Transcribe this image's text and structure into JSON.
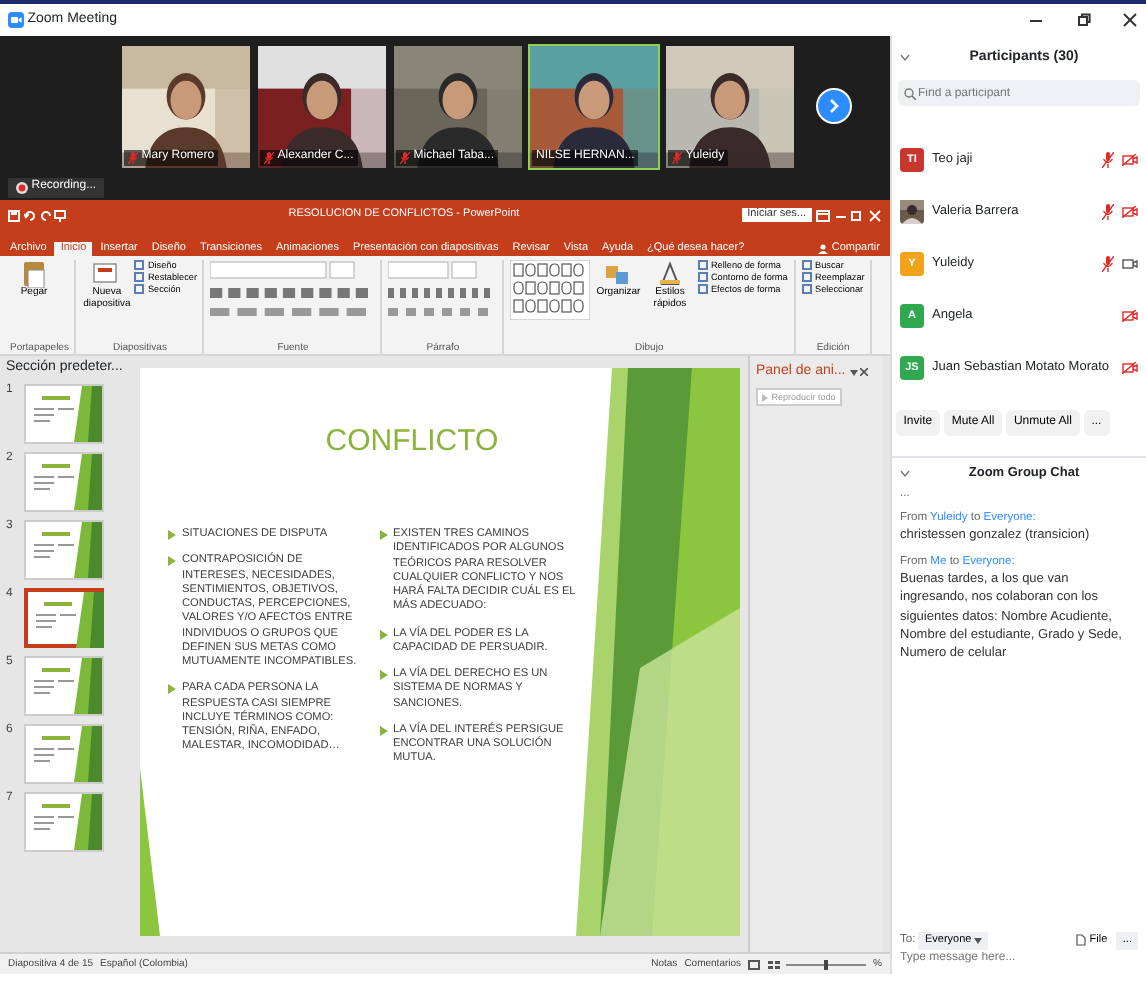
{
  "window": {
    "title": "Zoom Meeting"
  },
  "video_tiles": [
    {
      "name": "Mary Romero",
      "muted": true,
      "active": false
    },
    {
      "name": "Alexander C...",
      "muted": true,
      "active": false
    },
    {
      "name": "Michael Taba...",
      "muted": true,
      "active": false
    },
    {
      "name": "NILSE HERNAN...",
      "muted": false,
      "active": true
    },
    {
      "name": "Yuleidy",
      "muted": true,
      "active": false
    }
  ],
  "recording": {
    "label": "Recording..."
  },
  "powerpoint": {
    "title": "RESOLUCION DE CONFLICTOS - PowerPoint",
    "sign_in": "Iniciar ses...",
    "tabs": [
      {
        "label": "Archivo",
        "selected": false
      },
      {
        "label": "Inicio",
        "selected": true
      },
      {
        "label": "Insertar",
        "selected": false
      },
      {
        "label": "Diseño",
        "selected": false
      },
      {
        "label": "Transiciones",
        "selected": false
      },
      {
        "label": "Animaciones",
        "selected": false
      },
      {
        "label": "Presentación con diapositivas",
        "selected": false
      },
      {
        "label": "Revisar",
        "selected": false
      },
      {
        "label": "Vista",
        "selected": false
      },
      {
        "label": "Ayuda",
        "selected": false
      },
      {
        "label": "¿Qué desea hacer?",
        "selected": false
      }
    ],
    "share": "Compartir",
    "ribbon_groups": [
      {
        "label": "Portapapeles",
        "items": [
          {
            "kind": "large",
            "label": "Pegar"
          }
        ]
      },
      {
        "label": "Diapositivas",
        "items": [
          {
            "kind": "large",
            "label": "Nueva diapositiva"
          },
          {
            "kind": "small",
            "label": "Diseño"
          },
          {
            "kind": "small",
            "label": "Restablecer"
          },
          {
            "kind": "small",
            "label": "Sección"
          }
        ]
      },
      {
        "label": "Fuente",
        "items": [
          {
            "kind": "tools"
          }
        ]
      },
      {
        "label": "Párrafo",
        "items": [
          {
            "kind": "tools"
          }
        ]
      },
      {
        "label": "Dibujo",
        "items": [
          {
            "kind": "gallery"
          },
          {
            "kind": "large",
            "label": "Organizar"
          },
          {
            "kind": "large",
            "label": "Estilos rápidos"
          },
          {
            "kind": "small",
            "label": "Relleno de forma"
          },
          {
            "kind": "small",
            "label": "Contorno de forma"
          },
          {
            "kind": "small",
            "label": "Efectos de forma"
          }
        ]
      },
      {
        "label": "Edición",
        "items": [
          {
            "kind": "small",
            "label": "Buscar"
          },
          {
            "kind": "small",
            "label": "Reemplazar"
          },
          {
            "kind": "small",
            "label": "Seleccionar"
          }
        ]
      }
    ],
    "section": "Sección predeter...",
    "thumbnails": [
      {
        "number": "1",
        "selected": false
      },
      {
        "number": "2",
        "selected": false
      },
      {
        "number": "3",
        "selected": false
      },
      {
        "number": "4",
        "selected": true
      },
      {
        "number": "5",
        "selected": false
      },
      {
        "number": "6",
        "selected": false
      },
      {
        "number": "7",
        "selected": false
      }
    ],
    "slide": {
      "title": "CONFLICTO",
      "left_bullets": [
        "SITUACIONES DE DISPUTA",
        "CONTRAPOSICIÓN DE INTERESES, NECESIDADES, SENTIMIENTOS, OBJETIVOS, CONDUCTAS, PERCEPCIONES, VALORES Y/O AFECTOS ENTRE INDIVIDUOS O GRUPOS QUE DEFINEN SUS METAS COMO MUTUAMENTE INCOMPATIBLES.",
        "PARA CADA PERSONA LA RESPUESTA CASI SIEMPRE INCLUYE TÉRMINOS COMO: TENSIÓN, RIÑA, ENFADO, MALESTAR, INCOMODIDAD…"
      ],
      "right_bullets": [
        "EXISTEN TRES CAMINOS IDENTIFICADOS POR ALGUNOS TEÓRICOS PARA RESOLVER CUALQUIER CONFLICTO Y NOS HARÁ FALTA DECIDIR CUÁL ES EL MÁS ADECUADO:",
        "LA VÍA DEL PODER ES LA CAPACIDAD DE PERSUADIR.",
        "LA VÍA DEL DERECHO ES UN SISTEMA DE NORMAS Y SANCIONES.",
        "LA VÍA DEL INTERÉS PERSIGUE ENCONTRAR UNA SOLUCIÓN MUTUA."
      ]
    },
    "animation_pane": {
      "title": "Panel de ani...",
      "button": "Reproducir todo"
    },
    "status_bar": {
      "slide_count": "Diapositiva 4 de 15",
      "language": "Español (Colombia)",
      "notes": "Notas",
      "comments": "Comentarios",
      "zoom_slider": {
        "level": 0.5
      },
      "zoom": "%"
    }
  },
  "participants": {
    "title": "Participants (30)",
    "search_placeholder": "Find a participant",
    "items": [
      {
        "kind": "initials",
        "initials": "TI",
        "name": "Teo jaji",
        "color": "#c8372d",
        "audio_muted": true,
        "video_off": true
      },
      {
        "name": "Valeria Barrera",
        "audio_muted": true,
        "video_off": true
      },
      {
        "kind": "initials",
        "initials": "Y",
        "name": "Yuleidy",
        "color": "#f0a21b",
        "audio_muted": true,
        "video_off": false
      },
      {
        "kind": "initials",
        "initials": "A",
        "name": "Angela",
        "color": "#2fa84f",
        "audio_muted": false,
        "video_off": true
      },
      {
        "kind": "initials",
        "initials": "JS",
        "name": "Juan Sebastian Motato Morato",
        "color": "#2fa84f",
        "audio_muted": false,
        "video_off": true
      }
    ],
    "buttons": [
      "Invite",
      "Mute All",
      "Unmute All",
      "..."
    ]
  },
  "chat": {
    "title": "Zoom Group Chat",
    "ellipsis": "...",
    "messages": [
      {
        "from": "From",
        "sender": "Yuleidy",
        "to": "to",
        "recipient": "Everyone:",
        "text": "christessen gonzalez (transicion)"
      },
      {
        "from": "From",
        "sender": "Me",
        "to": "to",
        "recipient": "Everyone:",
        "text": "Buenas tardes, a los que van ingresando, nos colaboran con los siguientes datos: Nombre Acudiente, Nombre del estudiante, Grado y Sede, Numero de celular"
      }
    ],
    "to_label": "To:",
    "to_value": "Everyone",
    "file": "File",
    "more": "...",
    "placeholder": "Type message here..."
  }
}
